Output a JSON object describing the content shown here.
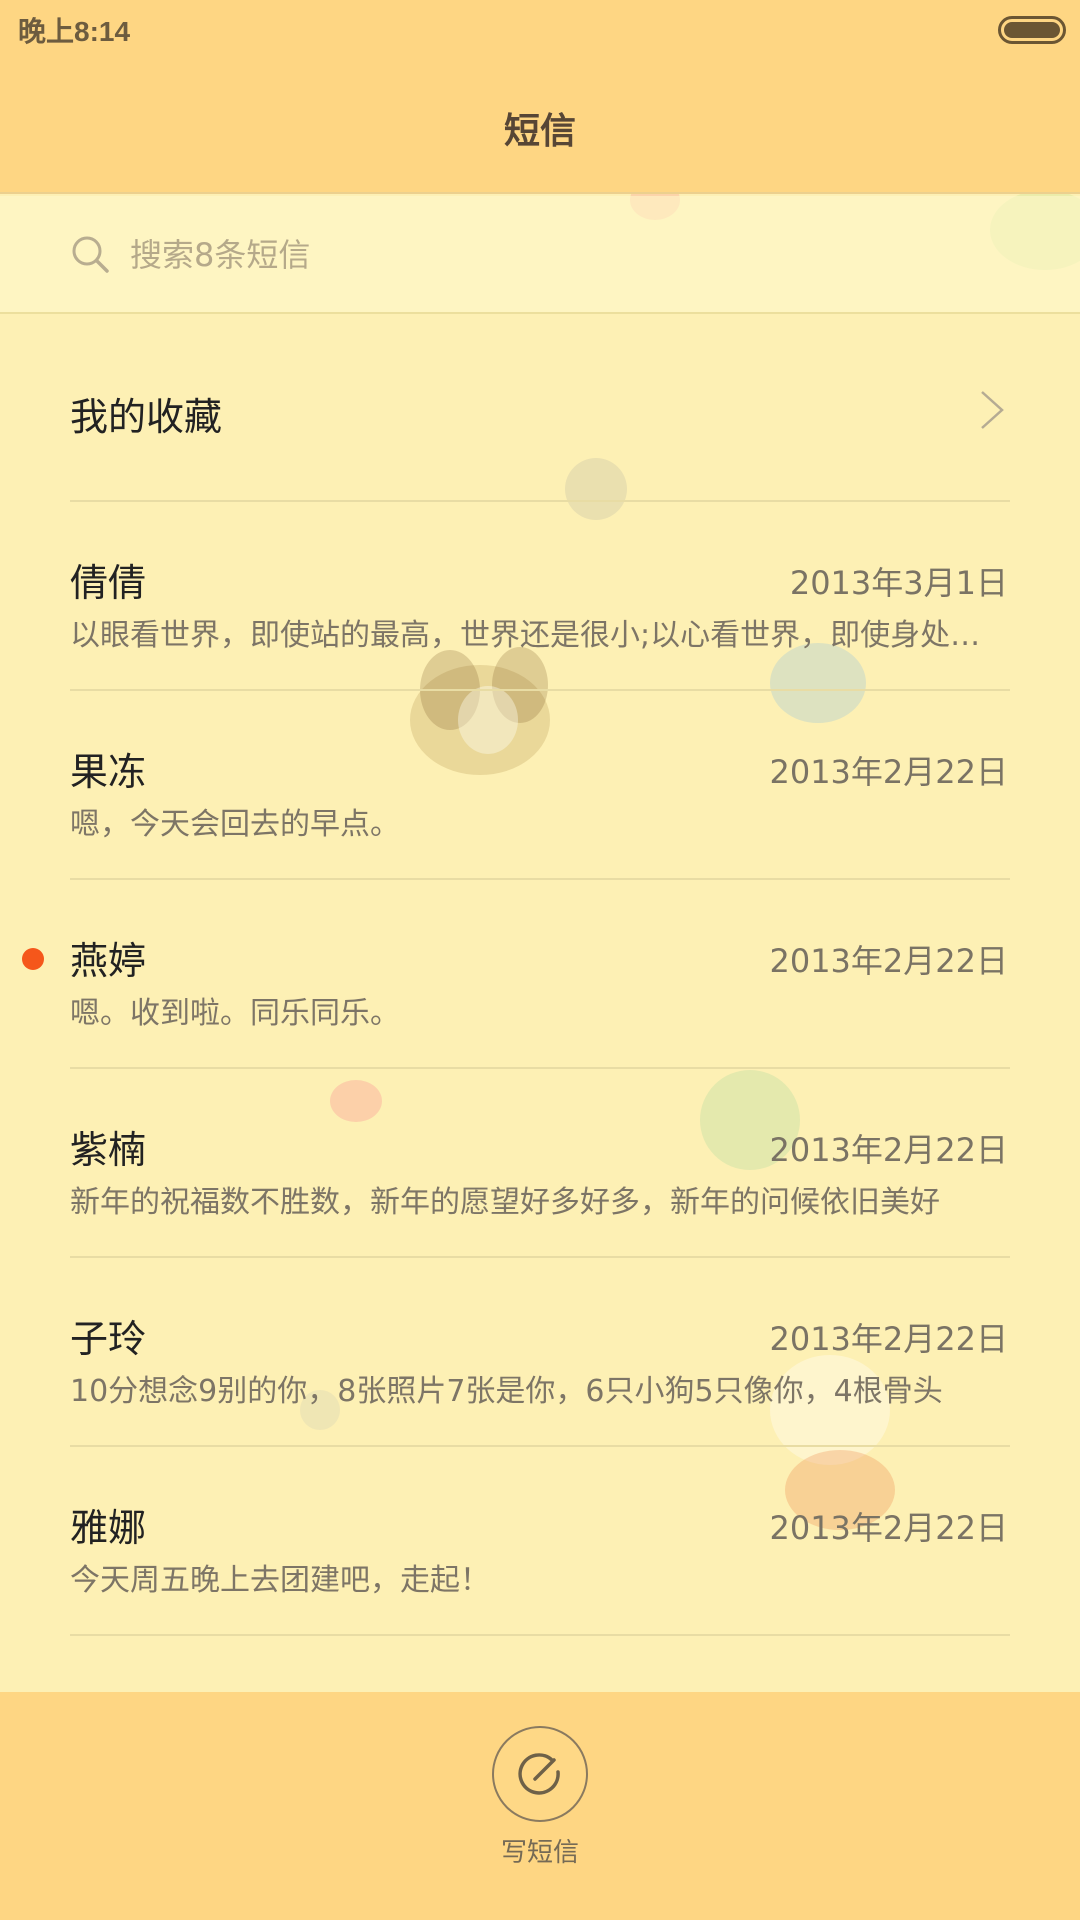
{
  "status_bar": {
    "time": "晚上8:14"
  },
  "header": {
    "title": "短信"
  },
  "search": {
    "placeholder": "搜索8条短信"
  },
  "favorites": {
    "label": "我的收藏"
  },
  "conversations": [
    {
      "name": "倩倩",
      "date": "2013年3月1日",
      "preview": "以眼看世界，即使站的最高，世界还是很小;以心看世界，即使身处最低处，世界也是很大",
      "unread": false
    },
    {
      "name": "果冻",
      "date": "2013年2月22日",
      "preview": "嗯，今天会回去的早点。",
      "unread": false
    },
    {
      "name": "燕婷",
      "date": "2013年2月22日",
      "preview": "嗯。收到啦。同乐同乐。",
      "unread": true
    },
    {
      "name": "紫楠",
      "date": "2013年2月22日",
      "preview": "新年的祝福数不胜数，新年的愿望好多好多，新年的问候依旧美好",
      "unread": false
    },
    {
      "name": "子玲",
      "date": "2013年2月22日",
      "preview": "10分想念9别的你，8张照片7张是你，6只小狗5只像你，4根骨头",
      "unread": false
    },
    {
      "name": "雅娜",
      "date": "2013年2月22日",
      "preview": "今天周五晚上去团建吧，走起！",
      "unread": false
    }
  ],
  "bottom": {
    "compose_label": "写短信"
  },
  "colors": {
    "header_bg": "#fed683",
    "body_bg": "#fdf0b4",
    "unread_dot": "#f5571b"
  },
  "icons": {
    "search": "search-icon",
    "chevron": "chevron-right-icon",
    "compose": "compose-icon",
    "battery": "battery-icon"
  }
}
